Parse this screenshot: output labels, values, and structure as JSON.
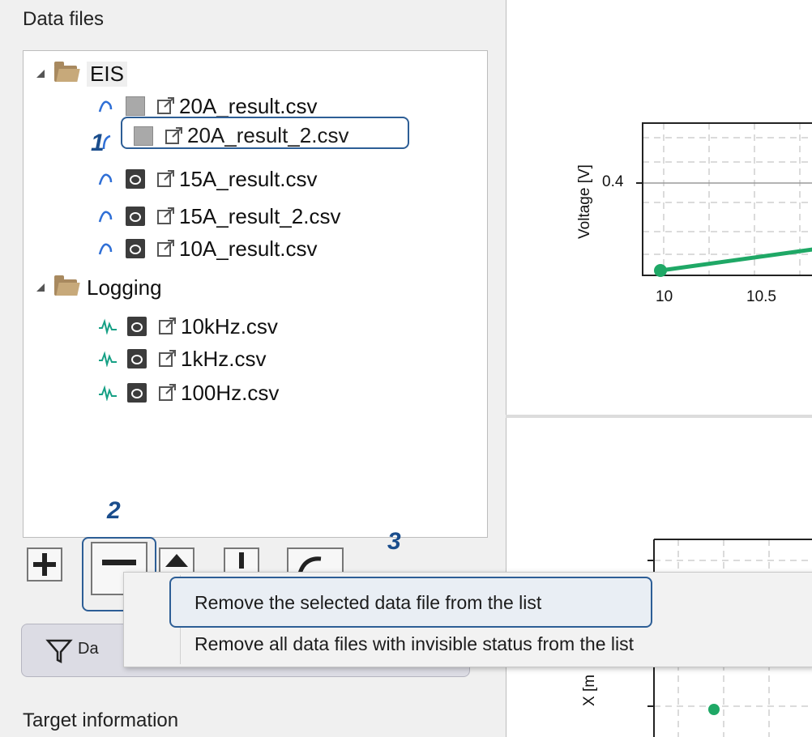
{
  "panel": {
    "title": "Data files",
    "footer_title": "Target information",
    "filter_button_label": "Da"
  },
  "tree": {
    "folders": [
      {
        "name": "EIS",
        "files": [
          {
            "name": "20A_result.csv",
            "visible": false
          },
          {
            "name": "20A_result_2.csv",
            "visible": false,
            "selected": true
          },
          {
            "name": "15A_result.csv",
            "visible": true
          },
          {
            "name": "15A_result_2.csv",
            "visible": true
          },
          {
            "name": "10A_result.csv",
            "visible": true
          }
        ]
      },
      {
        "name": "Logging",
        "files": [
          {
            "name": "10kHz.csv",
            "visible": true
          },
          {
            "name": "1kHz.csv",
            "visible": true
          },
          {
            "name": "100Hz.csv",
            "visible": true
          }
        ]
      }
    ]
  },
  "toolbar": {
    "buttons": [
      "add-icon",
      "remove-icon",
      "move-up-icon",
      "move-down-icon",
      "export-icon"
    ]
  },
  "context_menu": {
    "items": [
      {
        "label": "Remove the selected data file from the list",
        "highlighted": true
      },
      {
        "label": "Remove all data files with invisible status from the list",
        "highlighted": false
      }
    ]
  },
  "steps": {
    "one": "1",
    "two": "2",
    "three": "3"
  },
  "charts": {
    "top": {
      "ylabel": "Voltage [V]",
      "ytick": "0.4",
      "xticks": [
        "10",
        "10.5"
      ]
    },
    "bottom": {
      "ylabel": "X [m"
    }
  },
  "colors": {
    "accent": "#2d5e96",
    "series": "#1fa866",
    "eis_icon": "#2f6fd6",
    "logging_icon": "#16a085"
  }
}
